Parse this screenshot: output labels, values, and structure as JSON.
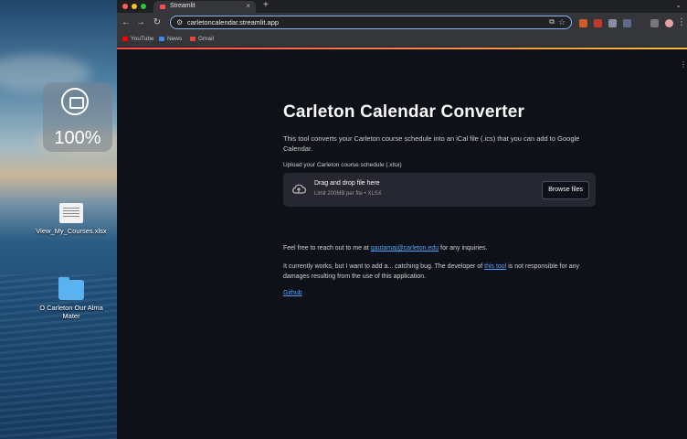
{
  "desktop": {
    "hud_value": "100%",
    "items": [
      {
        "label": "View_My_Courses.xlsx",
        "kind": "doc"
      },
      {
        "label": "O Carleton Our Alma Mater",
        "kind": "folder"
      }
    ]
  },
  "browser": {
    "tab_title": "Streamlit",
    "url": "carletoncalendar.streamlit.app",
    "bookmarks": [
      {
        "label": "YouTube",
        "color": "#ff0000"
      },
      {
        "label": "News",
        "color": "#4285f4"
      },
      {
        "label": "Gmail",
        "color": "#ea4335"
      }
    ]
  },
  "page": {
    "title": "Carleton Calendar Converter",
    "description": "This tool converts your Carleton course schedule into an iCal file (.ics) that you can add to Google Calendar.",
    "upload_label": "Upload your Carleton course schedule (.xlsx)",
    "dropzone_main": "Drag and drop file here",
    "dropzone_sub": "Limit 200MB per file • XLSX",
    "browse_label": "Browse files",
    "contact_prefix": "Feel free to reach out to me at",
    "contact_email": "gautamaj@carleton.edu",
    "contact_suffix": "for any inquiries.",
    "note_prefix": "It currently works, but I want to add a... catching bug. The developer of",
    "note_link": "this tool",
    "note_suffix": "is not responsible for any damages resulting from the use of this application.",
    "github_label": "Github"
  }
}
